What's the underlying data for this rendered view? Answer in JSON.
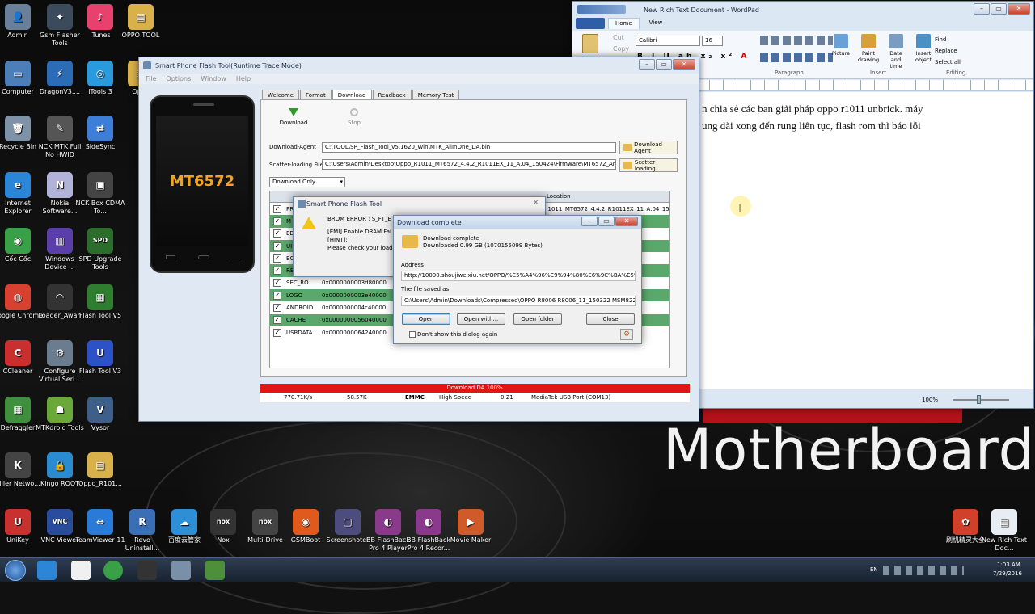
{
  "desktop": {
    "icons": [
      {
        "label": "Admin",
        "color": "#6a7f99",
        "glyph": "👤"
      },
      {
        "label": "Gsm Flasher Tools",
        "color": "#3b4b5c",
        "glyph": "✦"
      },
      {
        "label": "iTunes",
        "color": "#e8416d",
        "glyph": "♪"
      },
      {
        "label": "OPPO TOOL",
        "color": "#d9b14a",
        "glyph": "▤"
      },
      {
        "label": "Computer",
        "color": "#4c7fb8",
        "glyph": "▭"
      },
      {
        "label": "DragonV3....",
        "color": "#2c6bb5",
        "glyph": "⚡"
      },
      {
        "label": "iTools 3",
        "color": "#2a9adf",
        "glyph": "◎"
      },
      {
        "label": "Oppo",
        "color": "#d9b14a",
        "glyph": "▤"
      },
      {
        "label": "Recycle Bin",
        "color": "#7f93a8",
        "glyph": "🗑"
      },
      {
        "label": "NCK MTK Full No HWID",
        "color": "#555",
        "glyph": "✎"
      },
      {
        "label": "SideSync",
        "color": "#3d7fd8",
        "glyph": "⇄"
      },
      {
        "label": "Internet Explorer",
        "color": "#2b86d8",
        "glyph": "e"
      },
      {
        "label": "Nokia Software...",
        "color": "#b3b3d9",
        "glyph": "N"
      },
      {
        "label": "NCK Box CDMA To...",
        "color": "#444",
        "glyph": "▣"
      },
      {
        "label": "Cốc Cốc",
        "color": "#3aa047",
        "glyph": "◉"
      },
      {
        "label": "Windows Device ...",
        "color": "#5a3fa8",
        "glyph": "▥"
      },
      {
        "label": "SPD Upgrade Tools",
        "color": "#2b6e2b",
        "glyph": "SPD"
      },
      {
        "label": "Google Chrome",
        "color": "#d8402f",
        "glyph": "◍"
      },
      {
        "label": "Loader_Awan",
        "color": "#333",
        "glyph": "◠"
      },
      {
        "label": "Flash Tool V5",
        "color": "#2f7d2f",
        "glyph": "▦"
      },
      {
        "label": "CCleaner",
        "color": "#c92f2f",
        "glyph": "C"
      },
      {
        "label": "Configure Virtual Seri...",
        "color": "#6b7c8e",
        "glyph": "⚙"
      },
      {
        "label": "Flash Tool V3",
        "color": "#2d52c8",
        "glyph": "U"
      },
      {
        "label": "Defraggler",
        "color": "#3f8f3f",
        "glyph": "▦"
      },
      {
        "label": "MTKdroid Tools",
        "color": "#6aa83a",
        "glyph": "☗"
      },
      {
        "label": "Vysor",
        "color": "#3d5f8a",
        "glyph": "V"
      },
      {
        "label": "Killer Netwo...",
        "color": "#444",
        "glyph": "K"
      },
      {
        "label": "Kingo ROOT",
        "color": "#2a8bd0",
        "glyph": "🔒"
      },
      {
        "label": "Oppo_R101...",
        "color": "#d9b14a",
        "glyph": "▤"
      },
      {
        "label": "UniKey",
        "color": "#c93030",
        "glyph": "U"
      },
      {
        "label": "VNC Viewer",
        "color": "#2a4c9c",
        "glyph": "VNC"
      },
      {
        "label": "TeamViewer 11",
        "color": "#2a7ad8",
        "glyph": "⇔"
      },
      {
        "label": "Revo Uninstall...",
        "color": "#3a6fb5",
        "glyph": "R"
      },
      {
        "label": "百度云管家",
        "color": "#2e8fd6",
        "glyph": "☁"
      },
      {
        "label": "Nox",
        "color": "#333",
        "glyph": "nox"
      },
      {
        "label": "Multi-Drive",
        "color": "#444",
        "glyph": "nox"
      },
      {
        "label": "GSMBoot",
        "color": "#e05a1e",
        "glyph": "◉"
      },
      {
        "label": "Screenshoter",
        "color": "#4d4d7d",
        "glyph": "▢"
      },
      {
        "label": "BB FlashBack Pro 4 Player",
        "color": "#8a3a8a",
        "glyph": "◐"
      },
      {
        "label": "BB FlashBack Pro 4 Recor...",
        "color": "#8a3a8a",
        "glyph": "◐"
      },
      {
        "label": "Movie Maker",
        "color": "#cf5a2a",
        "glyph": "▶"
      },
      {
        "label": "刷机精灵大全",
        "color": "#d0402a",
        "glyph": "✿"
      },
      {
        "label": "New Rich Text Doc...",
        "color": "#e8edf4",
        "glyph": "▤"
      }
    ],
    "wallpaper_text": "Motherboard"
  },
  "flash_tool": {
    "title": "Smart Phone Flash Tool(Runtime Trace Mode)",
    "menu": [
      "File",
      "Options",
      "Window",
      "Help"
    ],
    "phone_model": "MT6572",
    "tabs": [
      "Welcome",
      "Format",
      "Download",
      "Readback",
      "Memory Test"
    ],
    "active_tab": "Download",
    "toolbar": {
      "download": "Download",
      "stop": "Stop"
    },
    "download_agent_label": "Download-Agent",
    "download_agent_value": "C:\\TOOL\\SP_Flash_Tool_v5.1620_Win\\MTK_AllInOne_DA.bin",
    "download_agent_button": "Download Agent",
    "scatter_label": "Scatter-loading File",
    "scatter_value": "C:\\Users\\Admin\\Desktop\\Oppo_R1011_MT6572_4.4.2_R1011EX_11_A.04_150424\\Firmware\\MT6572_Andro",
    "scatter_button": "Scatter-loading",
    "mode": "Download Only",
    "table_header_location": "Location",
    "rows": [
      {
        "name": "PR",
        "addr": "",
        "loc": "_1011_MT6572_4.4.2_R1011EX_11_A.04_15...",
        "green": false
      },
      {
        "name": "M",
        "addr": "",
        "loc": ".04_15...",
        "green": true
      },
      {
        "name": "EE",
        "addr": "",
        "loc": ".04_15...",
        "green": false
      },
      {
        "name": "UI",
        "addr": "",
        "loc": ".04_15...",
        "green": true
      },
      {
        "name": "BC",
        "addr": "",
        "loc": ".04_15...",
        "green": false
      },
      {
        "name": "RE",
        "addr": "",
        "loc": ".04_15...",
        "green": true
      },
      {
        "name": "SEC_RO",
        "addr": "0x0000000003d80000",
        "loc": ".04_15...",
        "green": false
      },
      {
        "name": "LOGO",
        "addr": "0x0000000003e40000",
        "loc": ".04_15...",
        "green": true
      },
      {
        "name": "ANDROID",
        "addr": "0x0000000004c40000",
        "loc": ".04_15...",
        "green": false
      },
      {
        "name": "CACHE",
        "addr": "0x0000000056040000",
        "loc": ".04_15...",
        "green": true
      },
      {
        "name": "USRDATA",
        "addr": "0x0000000064240000",
        "loc": ".04_15...",
        "green": false
      }
    ],
    "progress_text": "Download DA 100%",
    "status": {
      "speed": "770.71K/s",
      "size": "58.57K",
      "storage": "EMMC",
      "speed_mode": "High Speed",
      "time": "0:21",
      "port": "MediaTek USB Port (COM13)"
    }
  },
  "error_dialog": {
    "title": "Smart Phone Flash Tool",
    "line1": "BROM ERROR : S_FT_E",
    "line2": "[EMI] Enable DRAM Fai",
    "line3": "[HINT]:",
    "line4": "Please check your load"
  },
  "download_dialog": {
    "title": "Download complete",
    "heading": "Download complete",
    "detail": "Downloaded 0.99 GB (1070155099 Bytes)",
    "address_label": "Address",
    "address": "http://10000.shoujiweixiu.net/OPPO/%E5%A4%96%E9%94%80%E6%9C%BA%E5%",
    "saved_label": "The file saved as",
    "saved_path": "C:\\Users\\Admin\\Downloads\\Compressed\\OPPO R8006 R8006_11_150322 MSM8226.rar",
    "buttons": {
      "open": "Open",
      "open_with": "Open with...",
      "open_folder": "Open folder",
      "close": "Close"
    },
    "checkbox": "Don't show this dialog again"
  },
  "wordpad": {
    "title": "New Rich Text Document - WordPad",
    "tabs": [
      "Home",
      "View"
    ],
    "font": "Calibri",
    "size": "16",
    "clipboard": {
      "paste": "Paste",
      "cut": "Cut",
      "copy": "Copy"
    },
    "insert": [
      "Picture",
      "Paint drawing",
      "Date and time",
      "Insert object"
    ],
    "editing": [
      "Find",
      "Replace",
      "Select all"
    ],
    "groups": [
      "Paragraph",
      "Insert",
      "Editing"
    ],
    "text_line1": "n chia sẻ các ban giải pháp oppo r1011 unbrick. máy",
    "text_line2": "ung dài xong đến rung liên tục, flash rom thì báo lỗi",
    "zoom": "100%"
  },
  "taskbar": {
    "lang": "EN",
    "time": "1:03 AM",
    "date": "7/29/2016"
  }
}
